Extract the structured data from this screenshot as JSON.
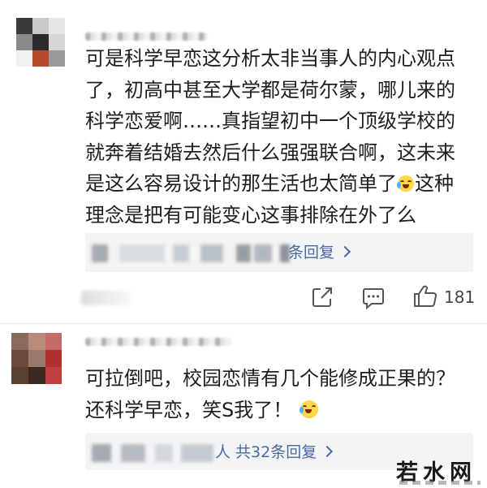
{
  "comments": [
    {
      "text_before_emoji": "可是科学早恋这分析太非当事人的内心观点\n了，初高中甚至大学都是荷尔蒙，哪儿来的\n科学恋爱啊……真指望初中一个顶级学校的\n就奔着结婚去然后什么强强联合啊，这未来\n是这么容易设计的那生活也太简单了",
      "text_after_emoji": "这种\n理念是把有可能变心这事排除在外了么",
      "reply_summary": "条回复",
      "like_count": "181",
      "avatar_colors": [
        "#3b3b3b",
        "#c9c9c9",
        "#e6e6e6",
        "#8a8a8a",
        "#2a2a2a",
        "#d6d6d6",
        "#f0f0f0",
        "#b84a2e",
        "#9a9a9a"
      ]
    },
    {
      "text_before_emoji": "可拉倒吧，校园恋情有几个能修成正果的？\n还科学早恋，笑S我了！",
      "text_after_emoji": "",
      "reply_summary": "人 共32条回复",
      "avatar_colors": [
        "#8a6a5a",
        "#b88a7a",
        "#c46a6a",
        "#6a4a3a",
        "#9a7a6a",
        "#b03030",
        "#5a4030",
        "#3a2a20",
        "#c04040"
      ]
    }
  ],
  "icons": {
    "share": "share-icon",
    "comment": "comment-icon",
    "like": "thumbs-up-icon",
    "emoji": "laughing-tears-emoji"
  },
  "watermark": "若水网",
  "colors": {
    "text": "#1e1e1e",
    "link": "#4a6a9c",
    "reply_bg": "#f3f4f6"
  }
}
